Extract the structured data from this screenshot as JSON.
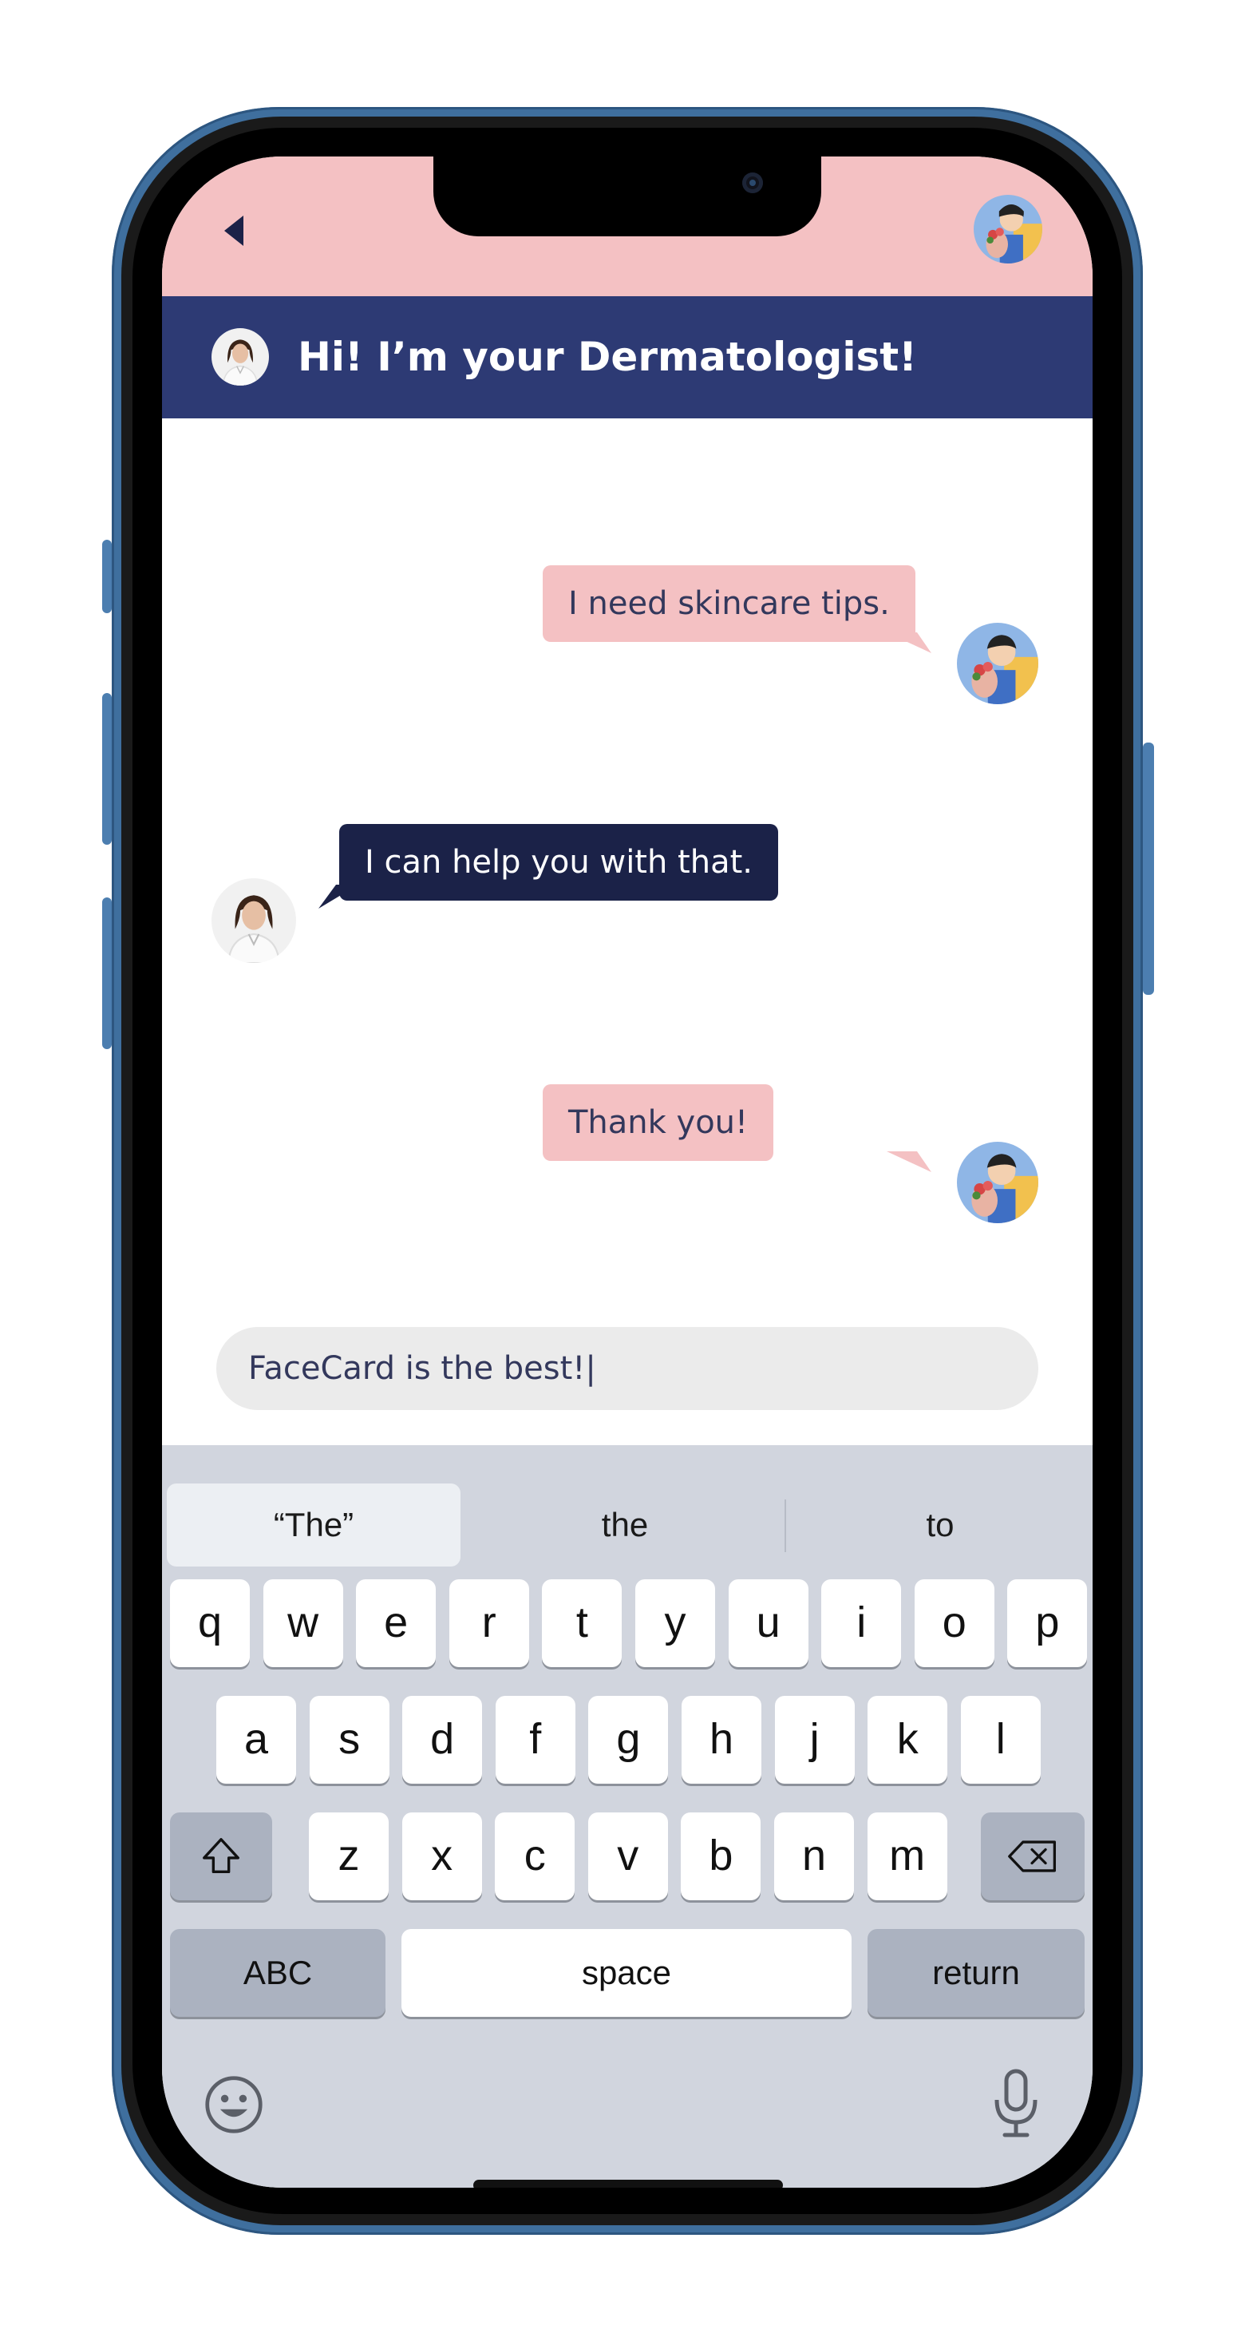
{
  "header": {
    "title": "Hi! I’m your Dermatologist!"
  },
  "messages": [
    {
      "from": "user",
      "text": "I need skincare tips."
    },
    {
      "from": "bot",
      "text": "I can help you with that."
    },
    {
      "from": "user",
      "text": "Thank you!"
    }
  ],
  "composer": {
    "value": "FaceCard is the best!|"
  },
  "keyboard": {
    "suggestions": [
      "“The”",
      "the",
      "to"
    ],
    "row1": [
      "q",
      "w",
      "e",
      "r",
      "t",
      "y",
      "u",
      "i",
      "o",
      "p"
    ],
    "row2": [
      "a",
      "s",
      "d",
      "f",
      "g",
      "h",
      "j",
      "k",
      "l"
    ],
    "row3": [
      "z",
      "x",
      "c",
      "v",
      "b",
      "n",
      "m"
    ],
    "abc_label": "ABC",
    "space_label": "space",
    "return_label": "return"
  },
  "colors": {
    "top_bar": "#f4c1c3",
    "header": "#2d3a74",
    "user_bubble": "#f4c1c3",
    "bot_bubble": "#1b2248",
    "keyboard": "#d1d5de"
  },
  "icons": [
    "back-arrow-icon",
    "user-avatar-icon",
    "doctor-avatar-icon",
    "shift-icon",
    "delete-icon",
    "emoji-icon",
    "microphone-icon"
  ]
}
